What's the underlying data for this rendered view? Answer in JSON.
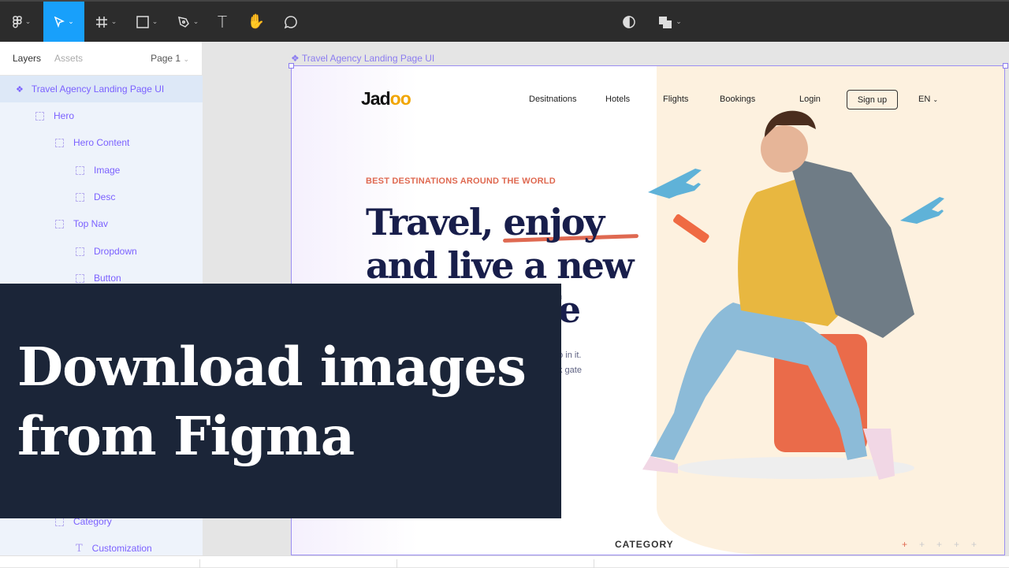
{
  "toolbar": {
    "tools": [
      "figma-menu",
      "move",
      "frame",
      "rectangle",
      "pen",
      "text",
      "hand",
      "comment"
    ],
    "active_tool": "move",
    "accent": "#18a0fb"
  },
  "panel": {
    "tabs": [
      "Layers",
      "Assets"
    ],
    "page": "Page 1",
    "layers": [
      {
        "label": "Travel Agency Landing Page UI",
        "type": "component",
        "selected": true
      },
      {
        "label": "Hero",
        "type": "frame"
      },
      {
        "label": "Hero Content",
        "type": "frame"
      },
      {
        "label": "Image",
        "type": "frame"
      },
      {
        "label": "Desc",
        "type": "frame"
      },
      {
        "label": "Top Nav",
        "type": "frame"
      },
      {
        "label": "Dropdown",
        "type": "frame"
      },
      {
        "label": "Button",
        "type": "frame"
      },
      {
        "label": "Category",
        "type": "frame"
      },
      {
        "label": "Customization",
        "type": "text"
      }
    ]
  },
  "canvas": {
    "frame_label": "Travel Agency Landing Page UI",
    "site": {
      "logo": "Jadoo",
      "nav": [
        "Desitnations",
        "Hotels",
        "Flights",
        "Bookings",
        "Login"
      ],
      "signup": "Sign up",
      "lang": "EN",
      "kicker": "BEST DESTINATIONS AROUND THE WORLD",
      "headline": [
        "Travel, enjoy",
        "and live a new",
        "fe"
      ],
      "desc": [
        "do in it.",
        "k gate"
      ],
      "category": "CATEGORY",
      "accent": "#df6951",
      "heading_color": "#181e4b"
    }
  },
  "overlay": {
    "lines": [
      "Download images",
      "from Figma"
    ]
  }
}
